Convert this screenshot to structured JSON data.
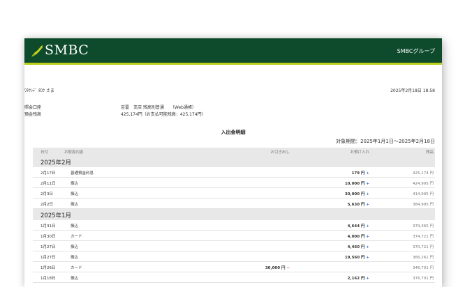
{
  "header": {
    "brand": "SMBC",
    "group": "SMBCグループ",
    "brand_color": "#0e4a2c",
    "accent_color": "#bccf1a"
  },
  "customer": {
    "name": "ﾜﾀｸｼﾃﾞ ﾀﾛｳ さま",
    "timestamp": "2025年2月18日 18:58"
  },
  "account": {
    "label": "照会口座",
    "value": "芸雷　支店 残高別普通　　（Web通帳）",
    "balance_label": "預金残高",
    "balance_value": "425,174円（お支払可能残高：425,174円）"
  },
  "statement": {
    "title": "入出金明細",
    "period": "対象期間：2025年1月1日〜2025年2月18日"
  },
  "table": {
    "headers": {
      "date": "日付",
      "description": "お取扱内容",
      "withdrawal": "お引き出し",
      "deposit": "お預け入れ",
      "balance": "残高"
    },
    "months": [
      {
        "label": "2025年2月",
        "rows": [
          {
            "date": "2月17日",
            "desc": "普通預金利息",
            "out": "",
            "in": "179 円",
            "balance": "425,174 円"
          },
          {
            "date": "2月11日",
            "desc": "振込",
            "out": "",
            "in": "10,000 円",
            "balance": "424,995 円"
          },
          {
            "date": "2月3日",
            "desc": "振込",
            "out": "",
            "in": "30,000 円",
            "balance": "414,995 円"
          },
          {
            "date": "2月2日",
            "desc": "振込",
            "out": "",
            "in": "5,630 円",
            "balance": "384,995 円"
          }
        ]
      },
      {
        "label": "2025年1月",
        "rows": [
          {
            "date": "1月31日",
            "desc": "振込",
            "out": "",
            "in": "4,644 円",
            "balance": "379,365 円"
          },
          {
            "date": "1月30日",
            "desc": "カード",
            "out": "",
            "in": "4,000 円",
            "balance": "374,721 円"
          },
          {
            "date": "1月27日",
            "desc": "振込",
            "out": "",
            "in": "4,460 円",
            "balance": "370,721 円"
          },
          {
            "date": "1月27日",
            "desc": "振込",
            "out": "",
            "in": "19,560 円",
            "balance": "366,261 円"
          },
          {
            "date": "1月26日",
            "desc": "カード",
            "out": "30,000 円",
            "in": "",
            "balance": "346,701 円"
          },
          {
            "date": "1月18日",
            "desc": "振込",
            "out": "",
            "in": "2,162 円",
            "balance": "376,701 円"
          }
        ]
      }
    ],
    "plus_sign": "+",
    "minus_sign": "−"
  }
}
